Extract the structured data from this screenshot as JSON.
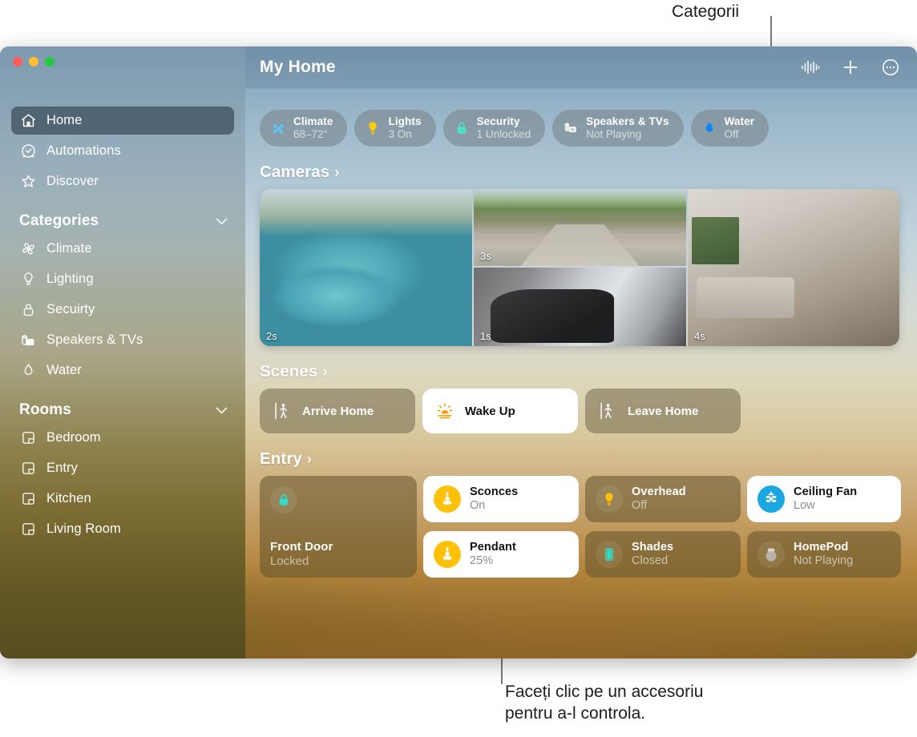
{
  "callouts": {
    "top": "Categorii",
    "bottom": "Faceți clic pe un accesoriu\npentru a-l controla."
  },
  "window": {
    "traffic_lights": [
      "close",
      "minimize",
      "zoom"
    ]
  },
  "header": {
    "title": "My Home",
    "actions": [
      {
        "name": "siri-waveform-icon",
        "label": "Siri"
      },
      {
        "name": "add-icon",
        "label": "Add"
      },
      {
        "name": "more-options-icon",
        "label": "More"
      }
    ]
  },
  "sidebar": {
    "primary": [
      {
        "label": "Home",
        "icon": "house-icon",
        "selected": true
      },
      {
        "label": "Automations",
        "icon": "clock-icon",
        "selected": false
      },
      {
        "label": "Discover",
        "icon": "star-icon",
        "selected": false
      }
    ],
    "categories_header": "Categories",
    "categories": [
      {
        "label": "Climate",
        "icon": "fan-icon"
      },
      {
        "label": "Lighting",
        "icon": "bulb-icon"
      },
      {
        "label": "Secuirty",
        "icon": "lock-icon"
      },
      {
        "label": "Speakers & TVs",
        "icon": "speaker-tv-icon"
      },
      {
        "label": "Water",
        "icon": "droplet-icon"
      }
    ],
    "rooms_header": "Rooms",
    "rooms": [
      {
        "label": "Bedroom",
        "icon": "room-icon"
      },
      {
        "label": "Entry",
        "icon": "room-icon"
      },
      {
        "label": "Kitchen",
        "icon": "room-icon"
      },
      {
        "label": "Living Room",
        "icon": "room-icon"
      }
    ]
  },
  "status_chips": [
    {
      "title": "Climate",
      "status": "68–72°",
      "icon": "fan-icon",
      "color": "#5ac8fa"
    },
    {
      "title": "Lights",
      "status": "3 On",
      "icon": "bulb-icon",
      "color": "#ffcc00"
    },
    {
      "title": "Security",
      "status": "1 Unlocked",
      "icon": "lock-icon",
      "color": "#4fe0c8"
    },
    {
      "title": "Speakers & TVs",
      "status": "Not Playing",
      "icon": "speaker-tv-icon",
      "color": "#e8e8e8"
    },
    {
      "title": "Water",
      "status": "Off",
      "icon": "droplet-icon",
      "color": "#0a84ff"
    }
  ],
  "sections": {
    "cameras": "Cameras",
    "scenes": "Scenes",
    "entry": "Entry",
    "arrow": "›"
  },
  "cameras": [
    {
      "name": "pool-camera",
      "timestamp": "2s"
    },
    {
      "name": "driveway-camera",
      "timestamp": "3s"
    },
    {
      "name": "garage-camera",
      "timestamp": "1s"
    },
    {
      "name": "living-room-camera",
      "timestamp": "4s"
    }
  ],
  "scenes": [
    {
      "label": "Arrive Home",
      "icon": "walk-in-icon",
      "active": false
    },
    {
      "label": "Wake Up",
      "icon": "sunrise-icon",
      "active": true
    },
    {
      "label": "Leave Home",
      "icon": "walk-out-icon",
      "active": false
    }
  ],
  "entry_accessories": [
    {
      "name": "front-door",
      "label": "Front Door",
      "status": "Locked",
      "icon": "lock-icon",
      "on": false,
      "large": true
    },
    {
      "name": "sconces",
      "label": "Sconces",
      "status": "On",
      "icon": "sconce-icon",
      "on": true
    },
    {
      "name": "overhead",
      "label": "Overhead",
      "status": "Off",
      "icon": "bulb-icon",
      "on": false
    },
    {
      "name": "ceiling-fan",
      "label": "Ceiling Fan",
      "status": "Low",
      "icon": "fan-icon",
      "on": true
    },
    {
      "name": "pendant",
      "label": "Pendant",
      "status": "25%",
      "icon": "sconce-icon",
      "on": true
    },
    {
      "name": "shades",
      "label": "Shades",
      "status": "Closed",
      "icon": "shade-icon",
      "on": false
    },
    {
      "name": "homepod",
      "label": "HomePod",
      "status": "Not Playing",
      "icon": "homepod-icon",
      "on": false
    }
  ]
}
